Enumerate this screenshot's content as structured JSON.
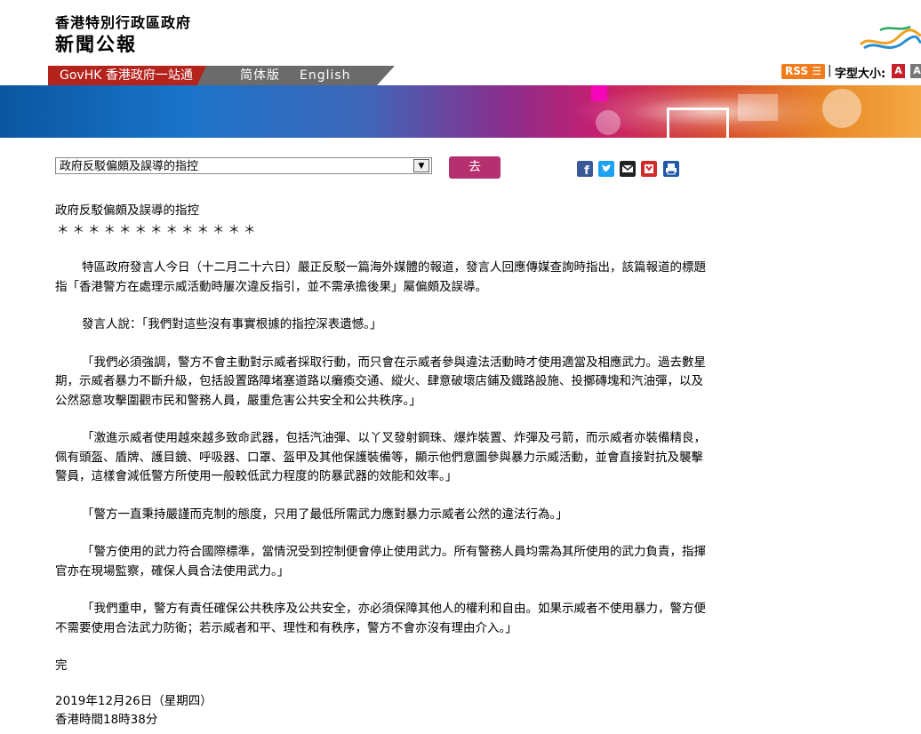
{
  "header": {
    "department": "香港特別行政區政府",
    "section": "新聞公報"
  },
  "nav": {
    "govhk": "GovHK 香港政府一站通",
    "simplified": "简体版",
    "english": "English"
  },
  "tools": {
    "rss": "RSS",
    "separator": "|",
    "font_size_label": "字型大小:",
    "font_a1": "A",
    "font_a2": "A"
  },
  "colors": {
    "brand_red": "#b5231d",
    "go_button": "#b5306f"
  },
  "dropdown": {
    "selected": "政府反駁偏頗及誤導的指控"
  },
  "go_label": "去",
  "share_icons": [
    "facebook-icon",
    "twitter-icon",
    "email-icon",
    "bookmark-icon",
    "print-icon"
  ],
  "article": {
    "title": "政府反駁偏頗及誤導的指控",
    "stars": "＊＊＊＊＊＊＊＊＊＊＊＊＊",
    "paragraphs": [
      "特區政府發言人今日（十二月二十六日）嚴正反駁一篇海外媒體的報道，發言人回應傳媒查詢時指出，該篇報道的標題指「香港警方在處理示威活動時屢次違反指引，並不需承擔後果」屬偏頗及誤導。",
      "發言人說：「我們對這些沒有事實根據的指控深表遺憾。」",
      "「我們必須強調，警方不會主動對示威者採取行動，而只會在示威者參與違法活動時才使用適當及相應武力。過去數星期，示威者暴力不斷升級，包括設置路障堵塞道路以癱瘓交通、縱火、肆意破壞店鋪及鐵路設施、投擲磚塊和汽油彈，以及公然惡意攻擊圍觀市民和警務人員，嚴重危害公共安全和公共秩序。」",
      "「激進示威者使用越來越多致命武器，包括汽油彈、以丫叉發射鋼珠、爆炸裝置、炸彈及弓箭，而示威者亦裝備精良，佩有頭盔、盾牌、護目鏡、呼吸器、口罩、盔甲及其他保護裝備等，顯示他們意圖參與暴力示威活動，並會直接對抗及襲擊警員，這樣會減低警方所使用一般較低武力程度的防暴武器的效能和效率。」",
      "「警方一直秉持嚴謹而克制的態度，只用了最低所需武力應對暴力示威者公然的違法行為。」",
      "「警方使用的武力符合國際標準，當情況受到控制便會停止使用武力。所有警務人員均需為其所使用的武力負責，指揮官亦在現場監察，確保人員合法使用武力。」",
      "「我們重申，警方有責任確保公共秩序及公共安全，亦必須保障其他人的權利和自由。如果示威者不使用暴力，警方便不需要使用合法武力防衛；若示威者和平、理性和有秩序，警方不會亦沒有理由介入。」"
    ],
    "end": "完",
    "date": "2019年12月26日（星期四）",
    "time": "香港時間18時38分"
  }
}
